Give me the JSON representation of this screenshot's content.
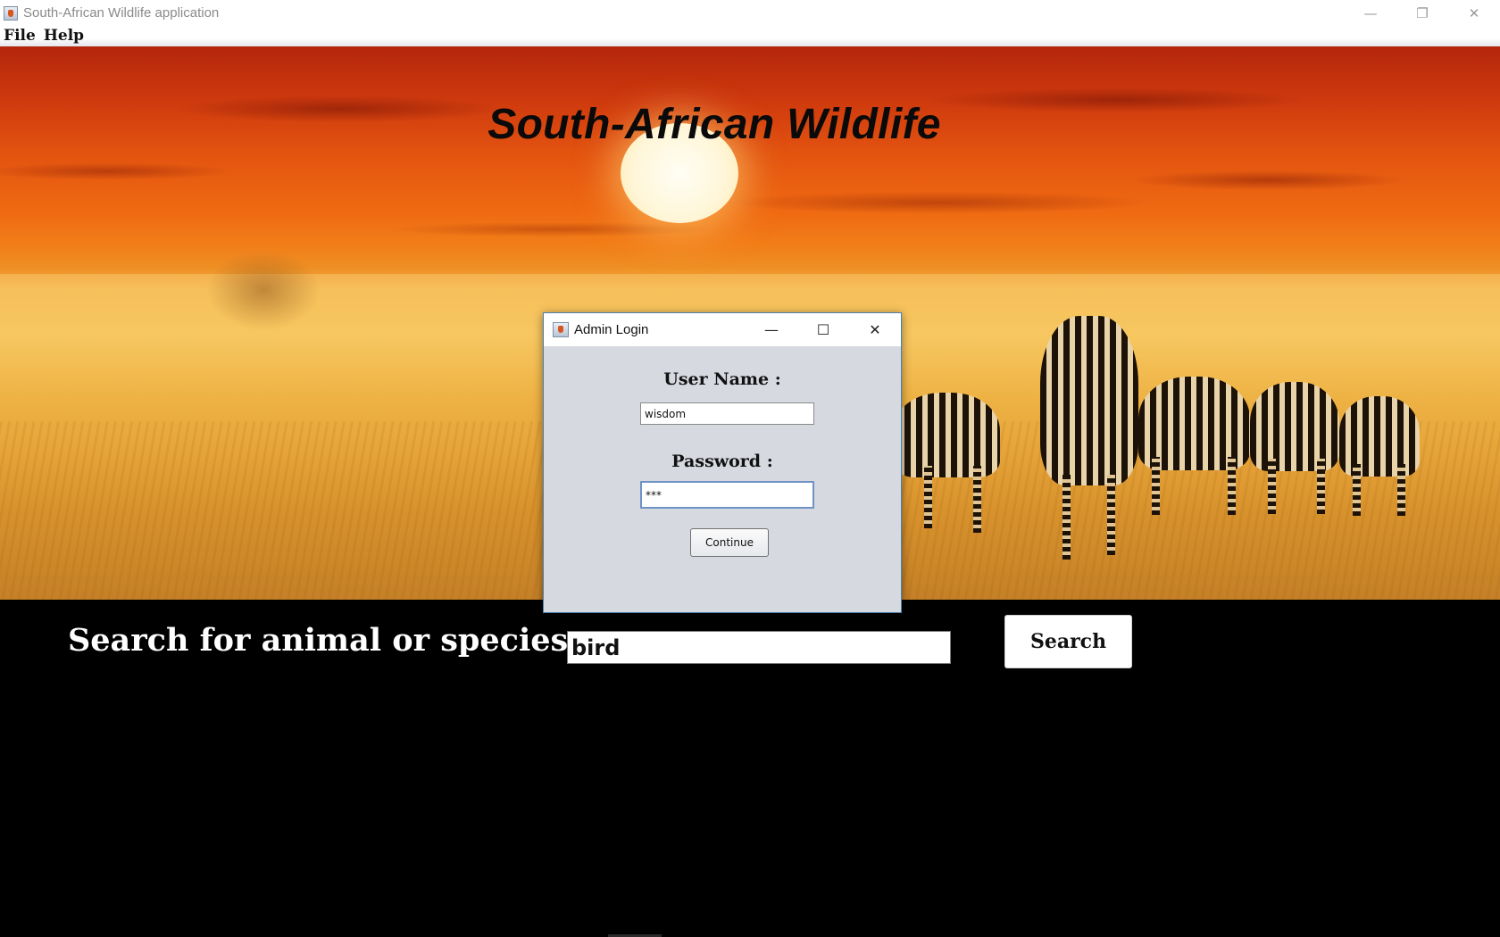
{
  "window": {
    "title": "South-African Wildlife application",
    "controls": {
      "minimize": "—",
      "restore": "❐",
      "close": "✕"
    }
  },
  "menu": [
    {
      "label": "File"
    },
    {
      "label": "Help"
    }
  ],
  "banner": {
    "title": "South-African Wildlife"
  },
  "search": {
    "label": "Search for animal or species :",
    "value": "bird",
    "button_label": "Search"
  },
  "dialog": {
    "title": "Admin Login",
    "controls": {
      "minimize": "—",
      "maximize": "☐",
      "close": "✕"
    },
    "username_label": "User Name :",
    "username_value": "wisdom",
    "password_label": "Password :",
    "password_value": "***",
    "continue_label": "Continue"
  },
  "colors": {
    "dialog_bg": "#d6d9e0",
    "dialog_border": "#4a7fb0",
    "background": "#000000",
    "banner_sky": "#e45510"
  },
  "icons": {
    "app": "java-coffee-cup-icon"
  }
}
